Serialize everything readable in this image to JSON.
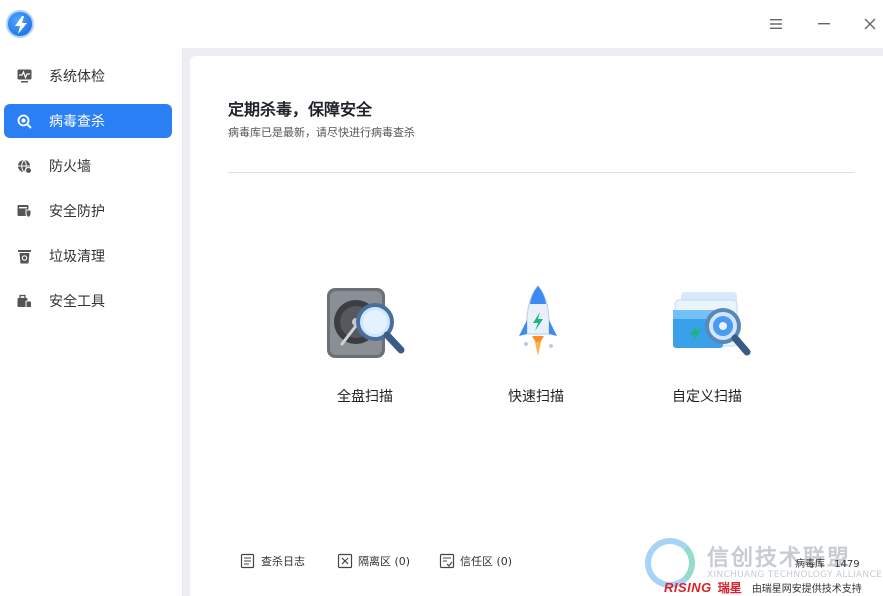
{
  "window": {
    "menu_icon": "menu-icon",
    "minimize_icon": "minimize-icon",
    "close_icon": "close-icon"
  },
  "sidebar": {
    "items": [
      {
        "label": "系统体检",
        "icon": "monitor-pulse-icon",
        "active": false
      },
      {
        "label": "病毒查杀",
        "icon": "virus-scan-icon",
        "active": true
      },
      {
        "label": "防火墙",
        "icon": "firewall-globe-icon",
        "active": false
      },
      {
        "label": "安全防护",
        "icon": "shield-folder-icon",
        "active": false
      },
      {
        "label": "垃圾清理",
        "icon": "trash-bin-icon",
        "active": false
      },
      {
        "label": "安全工具",
        "icon": "toolbox-icon",
        "active": false
      }
    ]
  },
  "main": {
    "headline": "定期杀毒，保障安全",
    "subline": "病毒库已是最新，请尽快进行病毒查杀",
    "scans": [
      {
        "label": "全盘扫描",
        "icon": "hard-disk-magnifier-icon"
      },
      {
        "label": "快速扫描",
        "icon": "rocket-icon"
      },
      {
        "label": "自定义扫描",
        "icon": "folder-magnifier-icon"
      }
    ]
  },
  "footer": {
    "log_label": "查杀日志",
    "quarantine_label": "隔离区 (0)",
    "trust_label": "信任区 (0)",
    "db_label": "病毒库",
    "db_version": "1479",
    "vendor_brand": "RISING",
    "vendor_cn": "瑞星",
    "vendor_text": "由瑞星网安提供技术支持"
  },
  "watermark": {
    "title": "信创技术联盟",
    "subtitle": "XINCHUANG TECHNOLOGY ALLIANCE"
  },
  "colors": {
    "accent": "#2b7ff5",
    "brand_red": "#d9232d"
  }
}
